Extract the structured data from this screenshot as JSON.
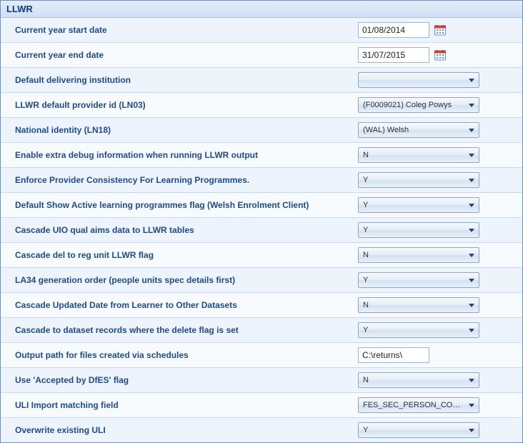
{
  "panel": {
    "title": "LLWR"
  },
  "rows": [
    {
      "label": "Current year start date",
      "control": "date",
      "value": "01/08/2014"
    },
    {
      "label": "Current year end date",
      "control": "date",
      "value": "31/07/2015"
    },
    {
      "label": "Default delivering institution",
      "control": "select",
      "value": ""
    },
    {
      "label": "LLWR default provider id (LN03)",
      "control": "select",
      "value": "(F0009021) Coleg Powys"
    },
    {
      "label": "National identity (LN18)",
      "control": "select",
      "value": "(WAL) Welsh"
    },
    {
      "label": "Enable extra debug information when running LLWR output",
      "control": "select",
      "value": "N"
    },
    {
      "label": "Enforce Provider Consistency For Learning Programmes.",
      "control": "select",
      "value": "Y"
    },
    {
      "label": "Default Show Active learning programmes flag (Welsh Enrolment Client)",
      "control": "select",
      "value": "Y"
    },
    {
      "label": "Cascade UIO qual aims data to LLWR tables",
      "control": "select",
      "value": "Y"
    },
    {
      "label": "Cascade del to reg unit LLWR flag",
      "control": "select",
      "value": "N"
    },
    {
      "label": "LA34 generation order (people units spec details first)",
      "control": "select",
      "value": "Y"
    },
    {
      "label": "Cascade Updated Date from Learner to Other Datasets",
      "control": "select",
      "value": "N"
    },
    {
      "label": "Cascade to dataset records where the delete flag is set",
      "control": "select",
      "value": "Y"
    },
    {
      "label": "Output path for files created via schedules",
      "control": "text",
      "value": "C:\\returns\\"
    },
    {
      "label": "Use 'Accepted by DfES' flag",
      "control": "select",
      "value": "N"
    },
    {
      "label": "ULI Import matching field",
      "control": "select",
      "value": "FES_SEC_PERSON_CODE"
    },
    {
      "label": "Overwrite existing ULI",
      "control": "select",
      "value": "Y"
    }
  ]
}
